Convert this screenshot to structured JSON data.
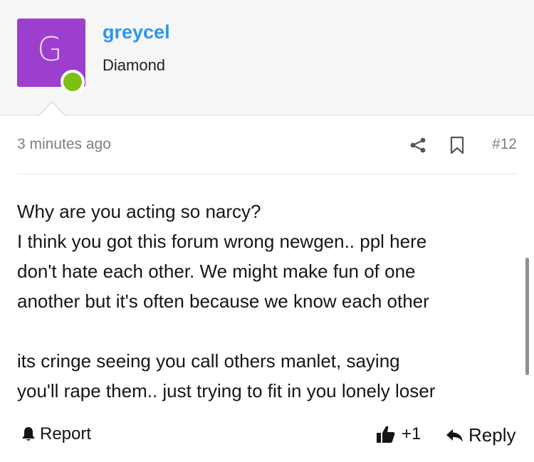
{
  "user": {
    "avatar_letter": "G",
    "name": "greycel",
    "title": "Diamond",
    "avatar_color": "#9c3fce",
    "online_color": "#7cc014"
  },
  "meta": {
    "timestamp": "3 minutes ago",
    "post_number": "#12",
    "share_icon": "share-icon",
    "bookmark_icon": "bookmark-icon"
  },
  "post": {
    "lines": [
      "Why are you acting so narcy?",
      "I think you got this forum wrong newgen.. ppl here",
      "don't hate each other. We might make fun of one",
      "another but it's often because we know each other",
      "",
      "its cringe seeing you call others manlet, saying",
      "you'll rape them.. just trying to fit in you lonely loser"
    ]
  },
  "actions": {
    "report_label": "Report",
    "like_count": "+1",
    "reply_label": "Reply"
  },
  "colors": {
    "link": "#2b96ef",
    "muted": "#7f7f7f"
  }
}
